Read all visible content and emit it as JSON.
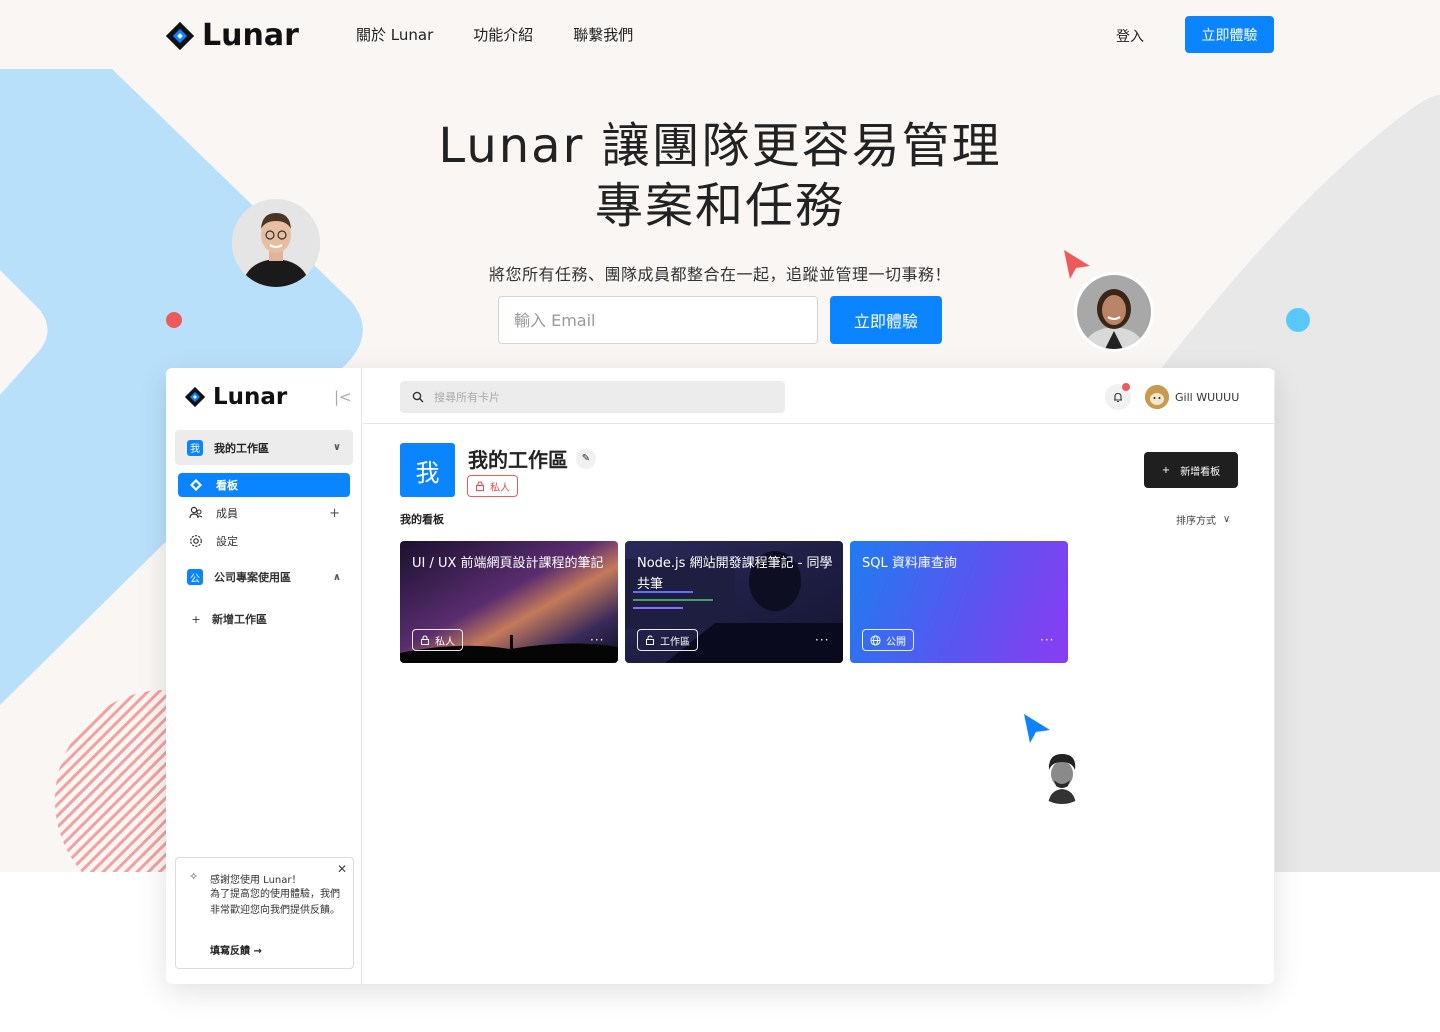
{
  "brand": {
    "name": "Lunar"
  },
  "nav": {
    "items": [
      "關於 Lunar",
      "功能介紹",
      "聯繫我們"
    ],
    "login": "登入",
    "cta": "立即體驗"
  },
  "hero": {
    "headline_line1": "Lunar 讓團隊更容易管理",
    "headline_line2": "專案和任務",
    "subheadline": "將您所有任務、團隊成員都整合在一起，追蹤並管理一切事務！",
    "email_placeholder": "輸入 Email",
    "cta": "立即體驗"
  },
  "app": {
    "sidebar": {
      "collapse_icon": "collapse-icon",
      "workspace": {
        "badge": "我",
        "label": "我的工作區"
      },
      "items": [
        {
          "label": "看板",
          "icon": "board-icon",
          "active": true
        },
        {
          "label": "成員",
          "icon": "members-icon"
        },
        {
          "label": "設定",
          "icon": "gear-icon"
        }
      ],
      "workspace2": {
        "badge": "公",
        "label": "公司專案使用區"
      },
      "add_workspace": "新增工作區",
      "feedback": {
        "title": "感謝您使用 Lunar！",
        "body": "為了提高您的使用體驗，我們非常歡迎您向我們提供反饋。",
        "link": "填寫反饋 →"
      }
    },
    "topbar": {
      "search_placeholder": "搜尋所有卡片",
      "user_name": "Gill WUUUU"
    },
    "workspace": {
      "badge": "我",
      "title": "我的工作區",
      "visibility": "私人",
      "add_board": "新增看板",
      "boards_label": "我的看板",
      "sort_label": "排序方式"
    },
    "boards": [
      {
        "title": "UI / UX 前端網頁設計課程的筆記",
        "tag": "私人",
        "tag_icon": "lock-icon"
      },
      {
        "title": "Node.js 網站開發課程筆記 - 同學共筆",
        "tag": "工作區",
        "tag_icon": "lock-open-icon"
      },
      {
        "title": "SQL 資料庫查詢",
        "tag": "公開",
        "tag_icon": "globe-icon"
      }
    ]
  },
  "colors": {
    "primary": "#0a84ff",
    "accent_red": "#ee5a5a",
    "dark": "#1f1f1f",
    "light_blue": "#b9e0fb"
  }
}
